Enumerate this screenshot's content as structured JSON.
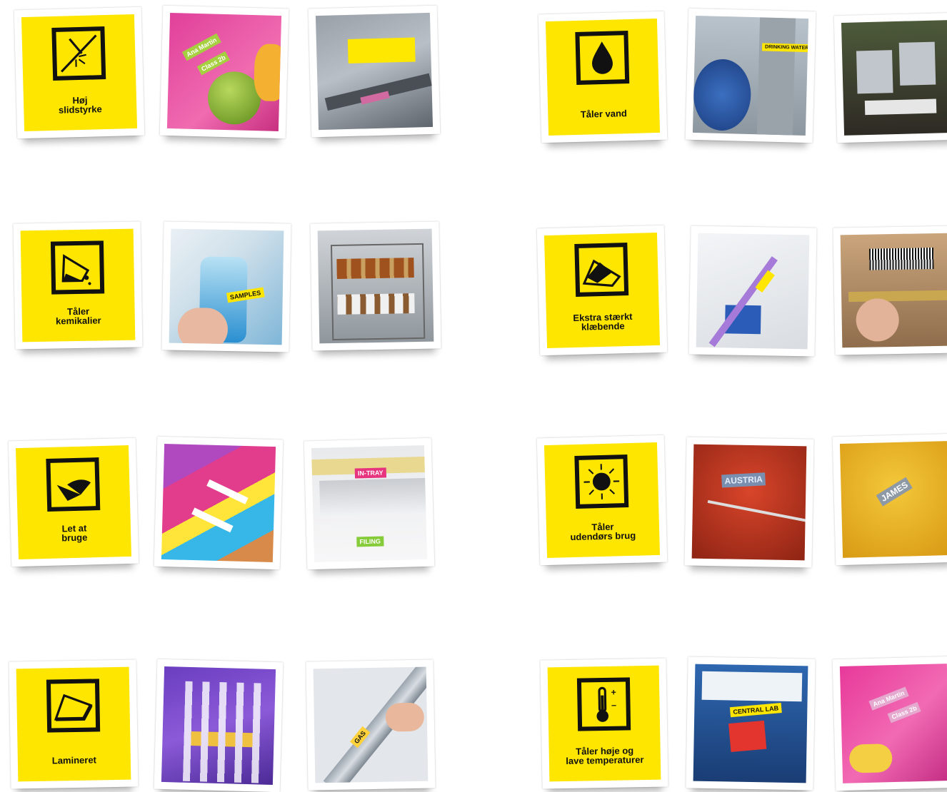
{
  "features": [
    {
      "caption": "Høj\nslidstyrke",
      "icon": "abrasion-icon"
    },
    {
      "caption": "Tåler\nkemikalier",
      "icon": "chemical-beaker-icon"
    },
    {
      "caption": "Let at\nbruge",
      "icon": "peel-label-icon"
    },
    {
      "caption": "Lamineret",
      "icon": "laminate-icon"
    },
    {
      "caption": "Tåler vand",
      "icon": "water-drop-icon"
    },
    {
      "caption": "Ekstra stærkt\nklæbende",
      "icon": "strong-adhesive-icon"
    },
    {
      "caption": "Tåler\nudendørs brug",
      "icon": "sun-icon"
    },
    {
      "caption": "Tåler høje og\nlave temperaturer",
      "icon": "thermometer-icon"
    }
  ],
  "photo_labels": {
    "lunchbox_1": "Ana Martin",
    "lunchbox_2": "Class 2b",
    "drinking_water": "DRINKING WATER",
    "samples": "SAMPLES",
    "in_tray": "IN-TRAY",
    "filing": "FILING",
    "austria": "AUSTRIA",
    "james": "JAMES",
    "gas": "GAS",
    "central_lab": "CENTRAL LAB",
    "lunchbox_3": "Ana Martin",
    "lunchbox_4": "Class 2b"
  },
  "colors": {
    "accent_yellow": "#ffe600",
    "icon_black": "#111111"
  }
}
